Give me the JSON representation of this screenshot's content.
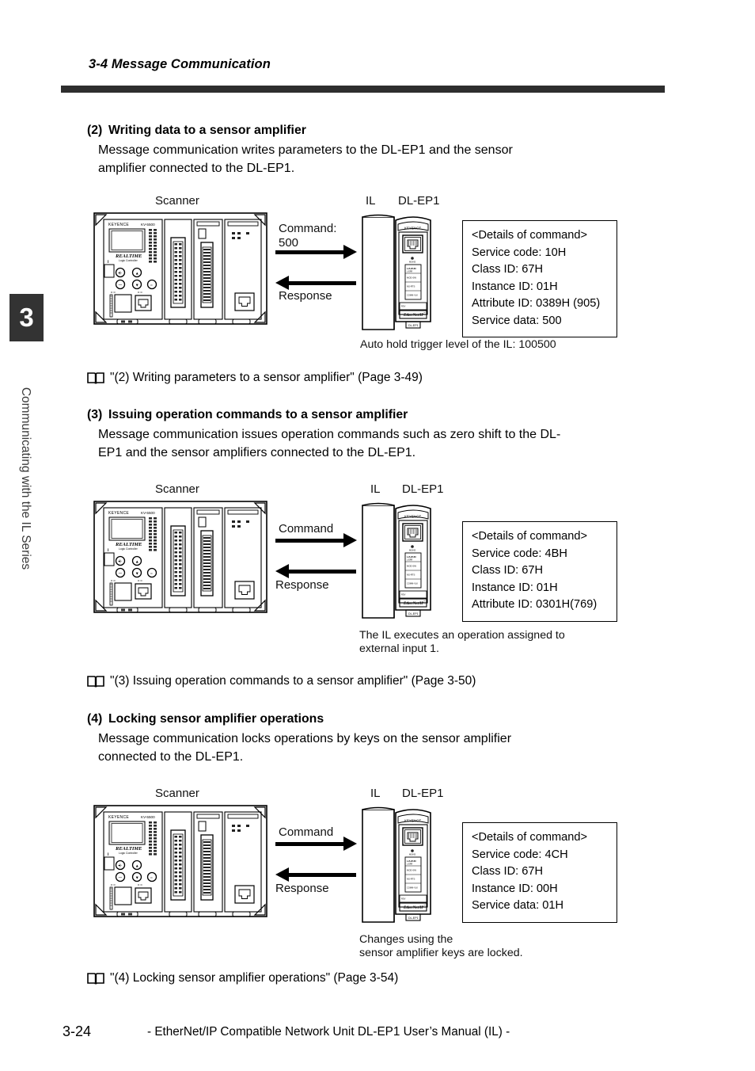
{
  "running_head": "3-4 Message Communication",
  "chapter_tab": {
    "number": "3",
    "side_text": "Communicating with the IL Series"
  },
  "sections": [
    {
      "number": "(2)",
      "title": "Writing data to a sensor amplifier",
      "body_main": "Message communication writes parameters to the DL-EP1 and the sensor",
      "body_last": "amplifier connected to the DL-EP1.",
      "reference": "\"(2) Writing parameters to a sensor amplifier\" (Page 3-49)"
    },
    {
      "number": "(3)",
      "title": "Issuing operation commands to a sensor amplifier",
      "body_main": "Message communication issues operation commands such as zero shift to the DL-",
      "body_last": "EP1 and the sensor amplifiers connected to the DL-EP1.",
      "reference": "\"(3) Issuing operation commands to a sensor amplifier\" (Page 3-50)"
    },
    {
      "number": "(4)",
      "title": "Locking sensor amplifier operations",
      "body_main": "Message communication locks operations by keys on the sensor amplifier",
      "body_last": "connected to the DL-EP1.",
      "reference": "\"(4) Locking sensor amplifier operations\" (Page 3-54)"
    }
  ],
  "figures": [
    {
      "scanner_label": "Scanner",
      "il_label": "IL",
      "dlep1_label": "DL-EP1",
      "command_label_line1": "Command:",
      "command_label_line2": "500",
      "response_label": "Response",
      "details_title": "<Details of command>",
      "details_rows": [
        "Service code: 10H",
        "Class ID: 67H",
        "Instance ID: 01H",
        "Attribute ID: 0389H (905)",
        "Service data: 500"
      ],
      "caption_line1": "Auto hold trigger level of the IL: 100500",
      "caption_line2": ""
    },
    {
      "scanner_label": "Scanner",
      "il_label": "IL",
      "dlep1_label": "DL-EP1",
      "command_label_line1": "Command",
      "command_label_line2": "",
      "response_label": "Response",
      "details_title": "<Details of command>",
      "details_rows": [
        "Service code: 4BH",
        "Class ID: 67H",
        "Instance ID: 01H",
        "Attribute ID: 0301H(769)"
      ],
      "caption_line1": "The IL executes an operation assigned to",
      "caption_line2": "external input 1."
    },
    {
      "scanner_label": "Scanner",
      "il_label": "IL",
      "dlep1_label": "DL-EP1",
      "command_label_line1": "Command",
      "command_label_line2": "",
      "response_label": "Response",
      "details_title": "<Details of command>",
      "details_rows": [
        "Service code: 4CH",
        "Class ID: 67H",
        "Instance ID: 00H",
        "Service data: 01H"
      ],
      "caption_line1": "Changes using the",
      "caption_line2": "sensor amplifier keys are locked."
    }
  ],
  "device_art": {
    "plc_brand": "KEYENCE",
    "plc_model": "KV-5500",
    "plc_display_text": "REALTIME",
    "plc_display_sub": "Logic Controller",
    "module_brand": "KEYENCE",
    "module_network": "EtherNet/IP",
    "module_name": "DL-EP1"
  },
  "footer": {
    "page_number": "3-24",
    "manual_line": "- EtherNet/IP Compatible Network Unit DL-EP1 User’s Manual (IL) -"
  },
  "colors": {
    "rule": "#2e2e2e",
    "tab": "#333333",
    "ink": "#000000"
  }
}
